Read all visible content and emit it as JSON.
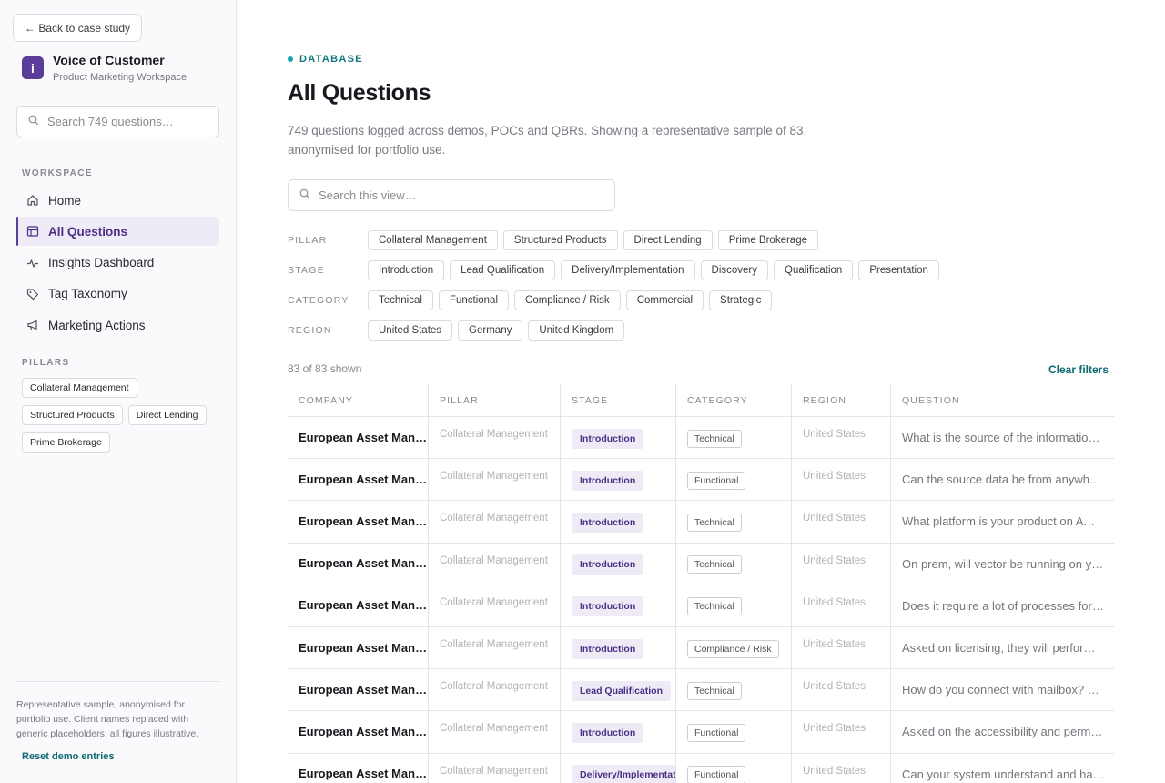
{
  "colors": {
    "accent": "#5b3c99",
    "teal": "#0e6b73",
    "stage_bg": "#efebf6"
  },
  "sidebar": {
    "back_label": "← Back to case study",
    "brand": {
      "logo_letter": "i",
      "title": "Voice of Customer",
      "subtitle": "Product Marketing Workspace"
    },
    "search_placeholder": "Search 749 questions…",
    "workspace_label": "WORKSPACE",
    "nav": [
      {
        "label": "Home",
        "icon": "home-icon",
        "active": false
      },
      {
        "label": "All Questions",
        "icon": "table-icon",
        "active": true
      },
      {
        "label": "Insights Dashboard",
        "icon": "pulse-icon",
        "active": false
      },
      {
        "label": "Tag Taxonomy",
        "icon": "tag-icon",
        "active": false
      },
      {
        "label": "Marketing Actions",
        "icon": "megaphone-icon",
        "active": false
      }
    ],
    "pillars_label": "PILLARS",
    "pillars": [
      "Collateral Management",
      "Structured Products",
      "Direct Lending",
      "Prime Brokerage"
    ],
    "footer_note": "Representative sample, anonymised for portfolio use. Client names replaced with generic placeholders; all figures illustrative.",
    "reset_label": "Reset demo entries"
  },
  "main": {
    "eyebrow": "DATABASE",
    "title": "All Questions",
    "description": "749 questions logged across demos, POCs and QBRs. Showing a representative sample of 83, anonymised for portfolio use.",
    "search_placeholder": "Search this view…",
    "filters": [
      {
        "label": "PILLAR",
        "chips": [
          "Collateral Management",
          "Structured Products",
          "Direct Lending",
          "Prime Brokerage"
        ]
      },
      {
        "label": "STAGE",
        "chips": [
          "Introduction",
          "Lead Qualification",
          "Delivery/Implementation",
          "Discovery",
          "Qualification",
          "Presentation"
        ]
      },
      {
        "label": "CATEGORY",
        "chips": [
          "Technical",
          "Functional",
          "Compliance / Risk",
          "Commercial",
          "Strategic"
        ]
      },
      {
        "label": "REGION",
        "chips": [
          "United States",
          "Germany",
          "United Kingdom"
        ]
      }
    ],
    "count": "83 of 83 shown",
    "clear_label": "Clear filters",
    "table": {
      "headers": [
        "COMPANY",
        "PILLAR",
        "STAGE",
        "CATEGORY",
        "REGION",
        "QUESTION"
      ],
      "rows": [
        {
          "company": "European Asset Man…",
          "pillar": "Collateral Management",
          "stage": "Introduction",
          "category": "Technical",
          "region": "United States",
          "question": "What is the source of the information …"
        },
        {
          "company": "European Asset Man…",
          "pillar": "Collateral Management",
          "stage": "Introduction",
          "category": "Functional",
          "region": "United States",
          "question": "Can the source data be from anywher…"
        },
        {
          "company": "European Asset Man…",
          "pillar": "Collateral Management",
          "stage": "Introduction",
          "category": "Technical",
          "region": "United States",
          "question": "What platform is your product on AW…"
        },
        {
          "company": "European Asset Man…",
          "pillar": "Collateral Management",
          "stage": "Introduction",
          "category": "Technical",
          "region": "United States",
          "question": "On prem, will vector be running on yo…"
        },
        {
          "company": "European Asset Man…",
          "pillar": "Collateral Management",
          "stage": "Introduction",
          "category": "Technical",
          "region": "United States",
          "question": "Does it require a lot of processes for o…"
        },
        {
          "company": "European Asset Man…",
          "pillar": "Collateral Management",
          "stage": "Introduction",
          "category": "Compliance / Risk",
          "region": "United States",
          "question": "Asked on licensing, they will perform d…"
        },
        {
          "company": "European Asset Man…",
          "pillar": "Collateral Management",
          "stage": "Lead Qualification",
          "category": "Technical",
          "region": "United States",
          "question": "How do you connect with mailbox? Wh…"
        },
        {
          "company": "European Asset Man…",
          "pillar": "Collateral Management",
          "stage": "Introduction",
          "category": "Functional",
          "region": "United States",
          "question": "Asked on the accessibility and permisi…"
        },
        {
          "company": "European Asset Man…",
          "pillar": "Collateral Management",
          "stage": "Delivery/Implementat",
          "category": "Functional",
          "region": "United States",
          "question": "Can your system understand and has l…"
        }
      ]
    }
  }
}
